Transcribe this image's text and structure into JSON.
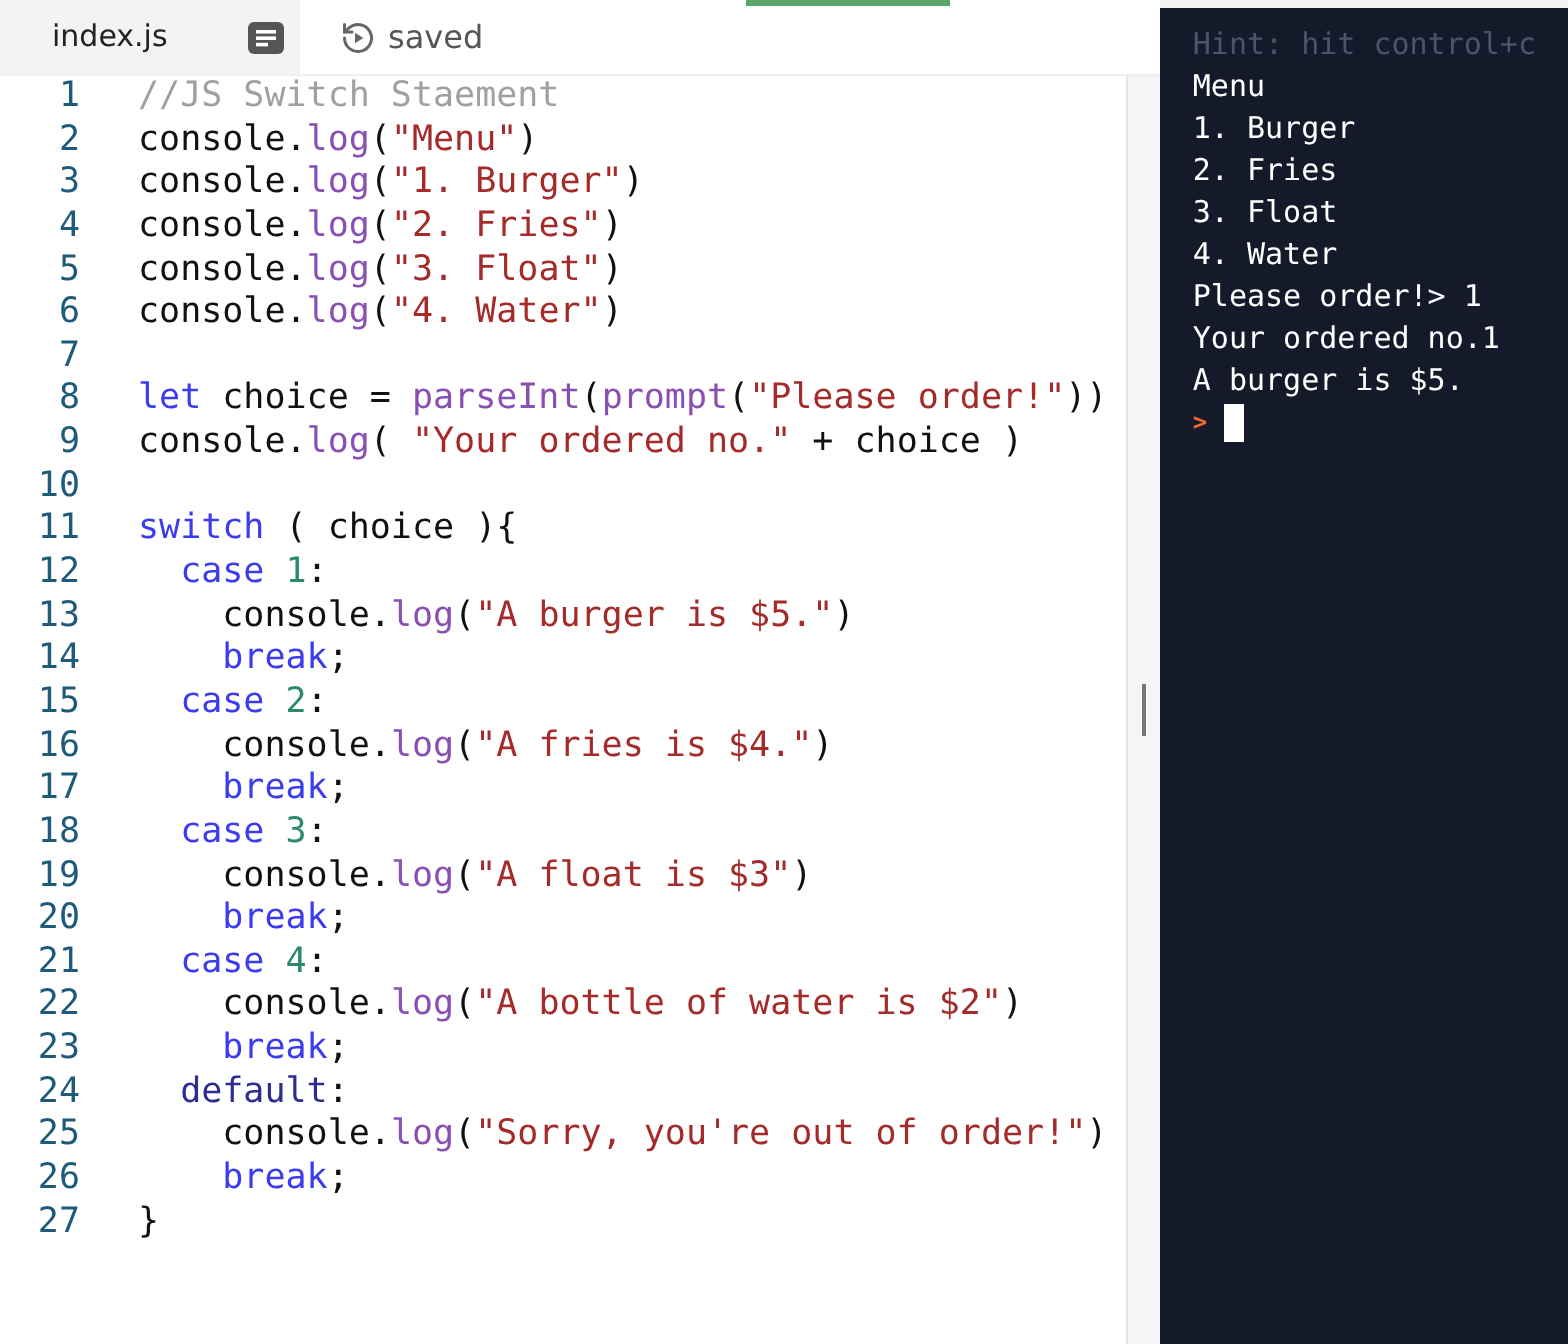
{
  "editor": {
    "tab": {
      "label": "index.js",
      "selected": true
    },
    "status": "saved",
    "lines": [
      {
        "number": "1",
        "tokens": [
          {
            "kind": "comment",
            "text": "//JS Switch Staement"
          }
        ]
      },
      {
        "number": "2",
        "tokens": [
          {
            "kind": "plain",
            "text": "console."
          },
          {
            "kind": "fn",
            "text": "log"
          },
          {
            "kind": "plain",
            "text": "("
          },
          {
            "kind": "str",
            "text": "\"Menu\""
          },
          {
            "kind": "plain",
            "text": ")"
          }
        ]
      },
      {
        "number": "3",
        "tokens": [
          {
            "kind": "plain",
            "text": "console."
          },
          {
            "kind": "fn",
            "text": "log"
          },
          {
            "kind": "plain",
            "text": "("
          },
          {
            "kind": "str",
            "text": "\"1. Burger\""
          },
          {
            "kind": "plain",
            "text": ")"
          }
        ]
      },
      {
        "number": "4",
        "tokens": [
          {
            "kind": "plain",
            "text": "console."
          },
          {
            "kind": "fn",
            "text": "log"
          },
          {
            "kind": "plain",
            "text": "("
          },
          {
            "kind": "str",
            "text": "\"2. Fries\""
          },
          {
            "kind": "plain",
            "text": ")"
          }
        ]
      },
      {
        "number": "5",
        "tokens": [
          {
            "kind": "plain",
            "text": "console."
          },
          {
            "kind": "fn",
            "text": "log"
          },
          {
            "kind": "plain",
            "text": "("
          },
          {
            "kind": "str",
            "text": "\"3. Float\""
          },
          {
            "kind": "plain",
            "text": ")"
          }
        ]
      },
      {
        "number": "6",
        "tokens": [
          {
            "kind": "plain",
            "text": "console."
          },
          {
            "kind": "fn",
            "text": "log"
          },
          {
            "kind": "plain",
            "text": "("
          },
          {
            "kind": "str",
            "text": "\"4. Water\""
          },
          {
            "kind": "plain",
            "text": ")"
          }
        ]
      },
      {
        "number": "7"
      },
      {
        "number": "8",
        "tokens": [
          {
            "kind": "kw",
            "text": "let"
          },
          {
            "kind": "plain",
            "text": " choice = "
          },
          {
            "kind": "fn",
            "text": "parseInt"
          },
          {
            "kind": "plain",
            "text": "("
          },
          {
            "kind": "fn",
            "text": "prompt"
          },
          {
            "kind": "plain",
            "text": "("
          },
          {
            "kind": "str",
            "text": "\"Please order!\""
          },
          {
            "kind": "plain",
            "text": "))"
          }
        ]
      },
      {
        "number": "9",
        "tokens": [
          {
            "kind": "plain",
            "text": "console."
          },
          {
            "kind": "fn",
            "text": "log"
          },
          {
            "kind": "plain",
            "text": "( "
          },
          {
            "kind": "str",
            "text": "\"Your ordered no.\""
          },
          {
            "kind": "plain",
            "text": " + choice )"
          }
        ]
      },
      {
        "number": "10"
      },
      {
        "number": "11",
        "tokens": [
          {
            "kind": "kw",
            "text": "switch"
          },
          {
            "kind": "plain",
            "text": " ( choice ){"
          }
        ]
      },
      {
        "number": "12",
        "tokens": [
          {
            "kind": "kw",
            "text": "  case"
          },
          {
            "kind": "num",
            "text": " 1"
          },
          {
            "kind": "plain",
            "text": ":"
          }
        ]
      },
      {
        "number": "13",
        "tokens": [
          {
            "kind": "plain",
            "text": "    console."
          },
          {
            "kind": "fn",
            "text": "log"
          },
          {
            "kind": "plain",
            "text": "("
          },
          {
            "kind": "str",
            "text": "\"A burger is $5.\""
          },
          {
            "kind": "plain",
            "text": ")"
          }
        ]
      },
      {
        "number": "14",
        "tokens": [
          {
            "kind": "kw",
            "text": "    break"
          },
          {
            "kind": "plain",
            "text": ";"
          }
        ]
      },
      {
        "number": "15",
        "tokens": [
          {
            "kind": "kw",
            "text": "  case"
          },
          {
            "kind": "num",
            "text": " 2"
          },
          {
            "kind": "plain",
            "text": ":"
          }
        ]
      },
      {
        "number": "16",
        "tokens": [
          {
            "kind": "plain",
            "text": "    console."
          },
          {
            "kind": "fn",
            "text": "log"
          },
          {
            "kind": "plain",
            "text": "("
          },
          {
            "kind": "str",
            "text": "\"A fries is $4.\""
          },
          {
            "kind": "plain",
            "text": ")"
          }
        ]
      },
      {
        "number": "17",
        "tokens": [
          {
            "kind": "kw",
            "text": "    break"
          },
          {
            "kind": "plain",
            "text": ";"
          }
        ]
      },
      {
        "number": "18",
        "tokens": [
          {
            "kind": "kw",
            "text": "  case"
          },
          {
            "kind": "num",
            "text": " 3"
          },
          {
            "kind": "plain",
            "text": ":"
          }
        ]
      },
      {
        "number": "19",
        "tokens": [
          {
            "kind": "plain",
            "text": "    console."
          },
          {
            "kind": "fn",
            "text": "log"
          },
          {
            "kind": "plain",
            "text": "("
          },
          {
            "kind": "str",
            "text": "\"A float is $3\""
          },
          {
            "kind": "plain",
            "text": ")"
          }
        ]
      },
      {
        "number": "20",
        "tokens": [
          {
            "kind": "kw",
            "text": "    break"
          },
          {
            "kind": "plain",
            "text": ";"
          }
        ]
      },
      {
        "number": "21",
        "tokens": [
          {
            "kind": "kw",
            "text": "  case"
          },
          {
            "kind": "num",
            "text": " 4"
          },
          {
            "kind": "plain",
            "text": ":"
          }
        ]
      },
      {
        "number": "22",
        "tokens": [
          {
            "kind": "plain",
            "text": "    console."
          },
          {
            "kind": "fn",
            "text": "log"
          },
          {
            "kind": "plain",
            "text": "("
          },
          {
            "kind": "str",
            "text": "\"A bottle of water is $2\""
          },
          {
            "kind": "plain",
            "text": ")"
          }
        ]
      },
      {
        "number": "23",
        "tokens": [
          {
            "kind": "kw",
            "text": "    break"
          },
          {
            "kind": "plain",
            "text": ";"
          }
        ]
      },
      {
        "number": "24",
        "tokens": [
          {
            "kind": "kw2",
            "text": "  default"
          },
          {
            "kind": "plain",
            "text": ":"
          }
        ]
      },
      {
        "number": "25",
        "tokens": [
          {
            "kind": "plain",
            "text": "    console."
          },
          {
            "kind": "fn",
            "text": "log"
          },
          {
            "kind": "plain",
            "text": "("
          },
          {
            "kind": "str",
            "text": "\"Sorry, you're out of order!\""
          },
          {
            "kind": "plain",
            "text": ")"
          }
        ]
      },
      {
        "number": "26",
        "tokens": [
          {
            "kind": "kw",
            "text": "    break"
          },
          {
            "kind": "plain",
            "text": ";"
          }
        ]
      },
      {
        "number": "27",
        "tokens": [
          {
            "kind": "plain",
            "text": "}"
          }
        ]
      }
    ]
  },
  "console": {
    "hint": "Hint: hit control+c",
    "output": [
      "Menu",
      "1. Burger",
      "2. Fries",
      "3. Float",
      "4. Water",
      "Please order!> 1",
      "Your ordered no.1",
      "A burger is $5."
    ],
    "prompt": ">"
  }
}
